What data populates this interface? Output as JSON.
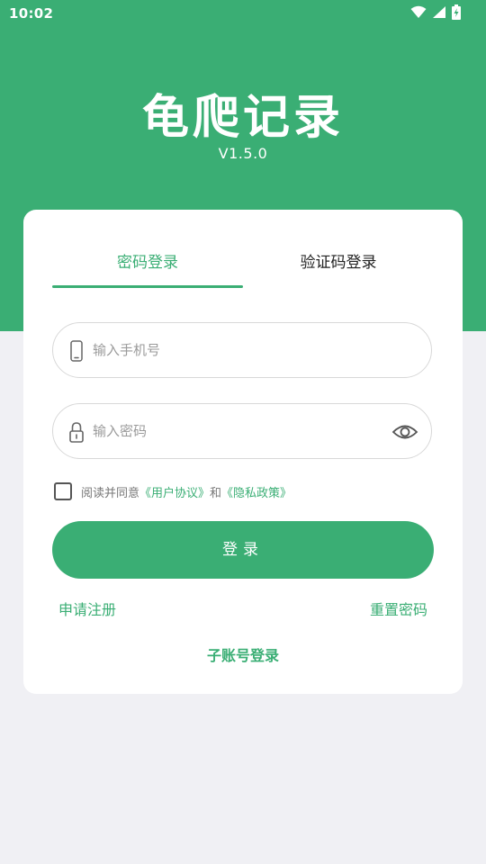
{
  "status_bar": {
    "time": "10:02",
    "icons": [
      "wifi-icon",
      "signal-icon",
      "battery-charging-icon"
    ]
  },
  "app": {
    "title": "龟爬记录",
    "version": "V1.5.0"
  },
  "colors": {
    "brand": "#3aae74",
    "background": "#f0f0f4"
  },
  "tabs": [
    {
      "label": "密码登录",
      "active": true
    },
    {
      "label": "验证码登录",
      "active": false
    }
  ],
  "form": {
    "phone": {
      "icon": "phone-icon",
      "value": "",
      "placeholder": "输入手机号"
    },
    "password": {
      "icon": "lock-icon",
      "value": "",
      "placeholder": "输入密码",
      "toggle_icon": "eye-icon"
    },
    "agreement": {
      "checked": false,
      "prefix": "阅读并同意",
      "user_agreement": "《用户协议》",
      "conjunction": "和",
      "privacy_policy": "《隐私政策》"
    },
    "login_label": "登录"
  },
  "links": {
    "register": "申请注册",
    "reset_password": "重置密码",
    "sub_account": "子账号登录"
  }
}
